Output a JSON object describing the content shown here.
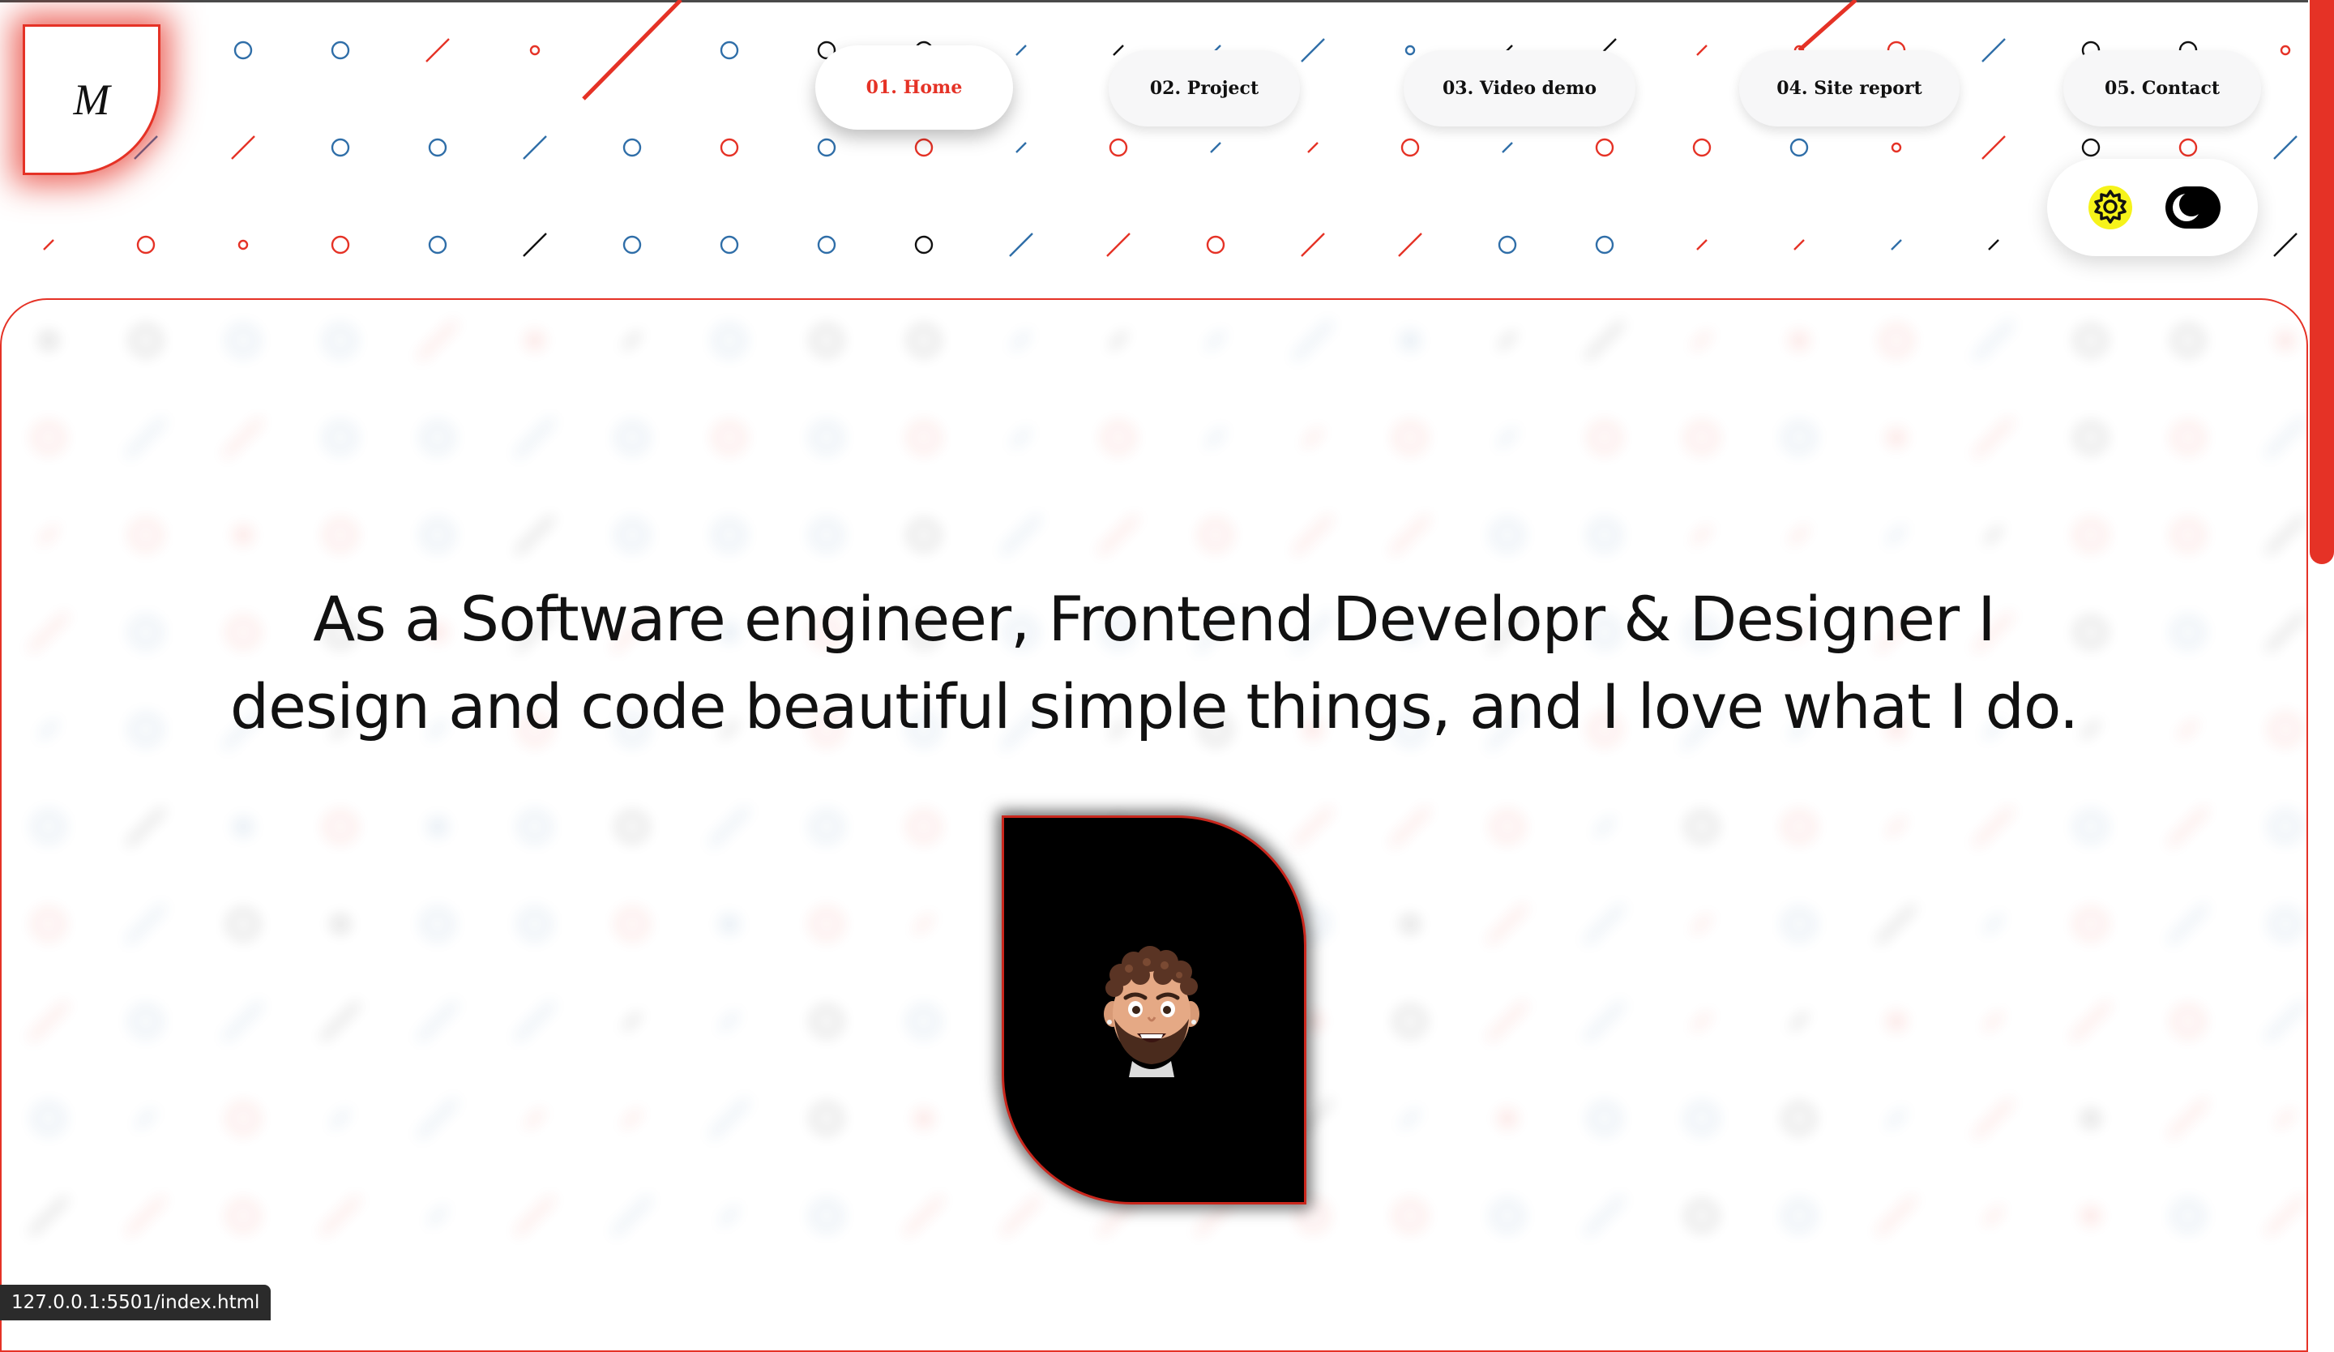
{
  "logo": {
    "letter": "M"
  },
  "nav": {
    "items": [
      {
        "label": "01. Home",
        "active": true
      },
      {
        "label": "02. Project",
        "active": false
      },
      {
        "label": "03. Video demo",
        "active": false
      },
      {
        "label": "04. Site report",
        "active": false
      },
      {
        "label": "05. Contact",
        "active": false
      }
    ]
  },
  "theme_toggle": {
    "light_icon": "sun-gear-icon",
    "dark_icon": "moon-icon"
  },
  "hero": {
    "line1": "As a Software engineer, Frontend Developr & Designer I",
    "line2": "design and code beautiful simple things, and I love what I do.",
    "avatar_icon": "memoji-avatar-icon"
  },
  "status_bar": {
    "url": "127.0.0.1:5501/index.html"
  },
  "colors": {
    "accent": "#e53226",
    "blue": "#2f6ea8",
    "text": "#111111",
    "background": "#ffffff"
  }
}
